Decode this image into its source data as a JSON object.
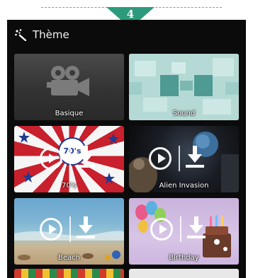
{
  "step": {
    "number": "4"
  },
  "header": {
    "title": "Thème",
    "icon": "magic-wand-icon"
  },
  "themes": [
    {
      "label": "Basique",
      "icon": "video-camera-icon"
    },
    {
      "label": "Sound"
    },
    {
      "label": "70's",
      "badge": "70's"
    },
    {
      "label": "Alien Invasion"
    },
    {
      "label": "Beach"
    },
    {
      "label": "Birthday"
    }
  ],
  "colors": {
    "accent": "#2d9a7e",
    "background": "#0b0b0b"
  }
}
